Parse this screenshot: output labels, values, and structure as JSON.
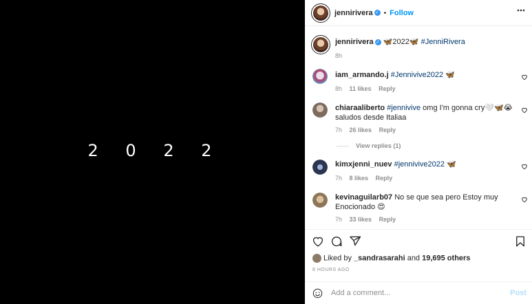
{
  "media": {
    "text": "2 0 2 2"
  },
  "header": {
    "username": "jennirivera",
    "verified_glyph": "✓",
    "separator": "•",
    "follow_label": "Follow",
    "more_icon": "more-horizontal-icon"
  },
  "caption": {
    "username": "jennirivera",
    "text_prefix": "🦋2022🦋",
    "hashtag": "#JenniRivera",
    "time": "8h"
  },
  "comments": [
    {
      "username": "iam_armando.j",
      "text": "",
      "hashtag": "#Jennivive2022",
      "suffix": " 🦋",
      "time": "8h",
      "likes": "11 likes",
      "reply": "Reply",
      "avatar_color": "#c9b4c4"
    },
    {
      "username": "chiaraaliberto",
      "text": "",
      "hashtag": "#jennivive",
      "suffix": " omg I'm gonna cry🤍🦋😭 saludos desde Italiaa",
      "time": "7h",
      "likes": "26 likes",
      "reply": "Reply",
      "avatar_color": "#a89a8e",
      "view_replies": "View replies (1)"
    },
    {
      "username": "kimxjenni_nuev",
      "text": "",
      "hashtag": "#jennivive2022",
      "suffix": " 🦋",
      "time": "7h",
      "likes": "8 likes",
      "reply": "Reply",
      "avatar_color": "#3b4a66"
    },
    {
      "username": "kevinaguilarb07",
      "text": " No se que sea pero Estoy muy Enocionado 😍",
      "hashtag": "",
      "suffix": "",
      "time": "7h",
      "likes": "33 likes",
      "reply": "Reply",
      "avatar_color": "#b59a78"
    }
  ],
  "likes": {
    "prefix": "Liked by ",
    "user": "_sandrasarahi",
    "middle": " and ",
    "others": "19,695 others"
  },
  "timestamp": "8 HOURS AGO",
  "comment_box": {
    "placeholder": "Add a comment...",
    "post_label": "Post"
  }
}
